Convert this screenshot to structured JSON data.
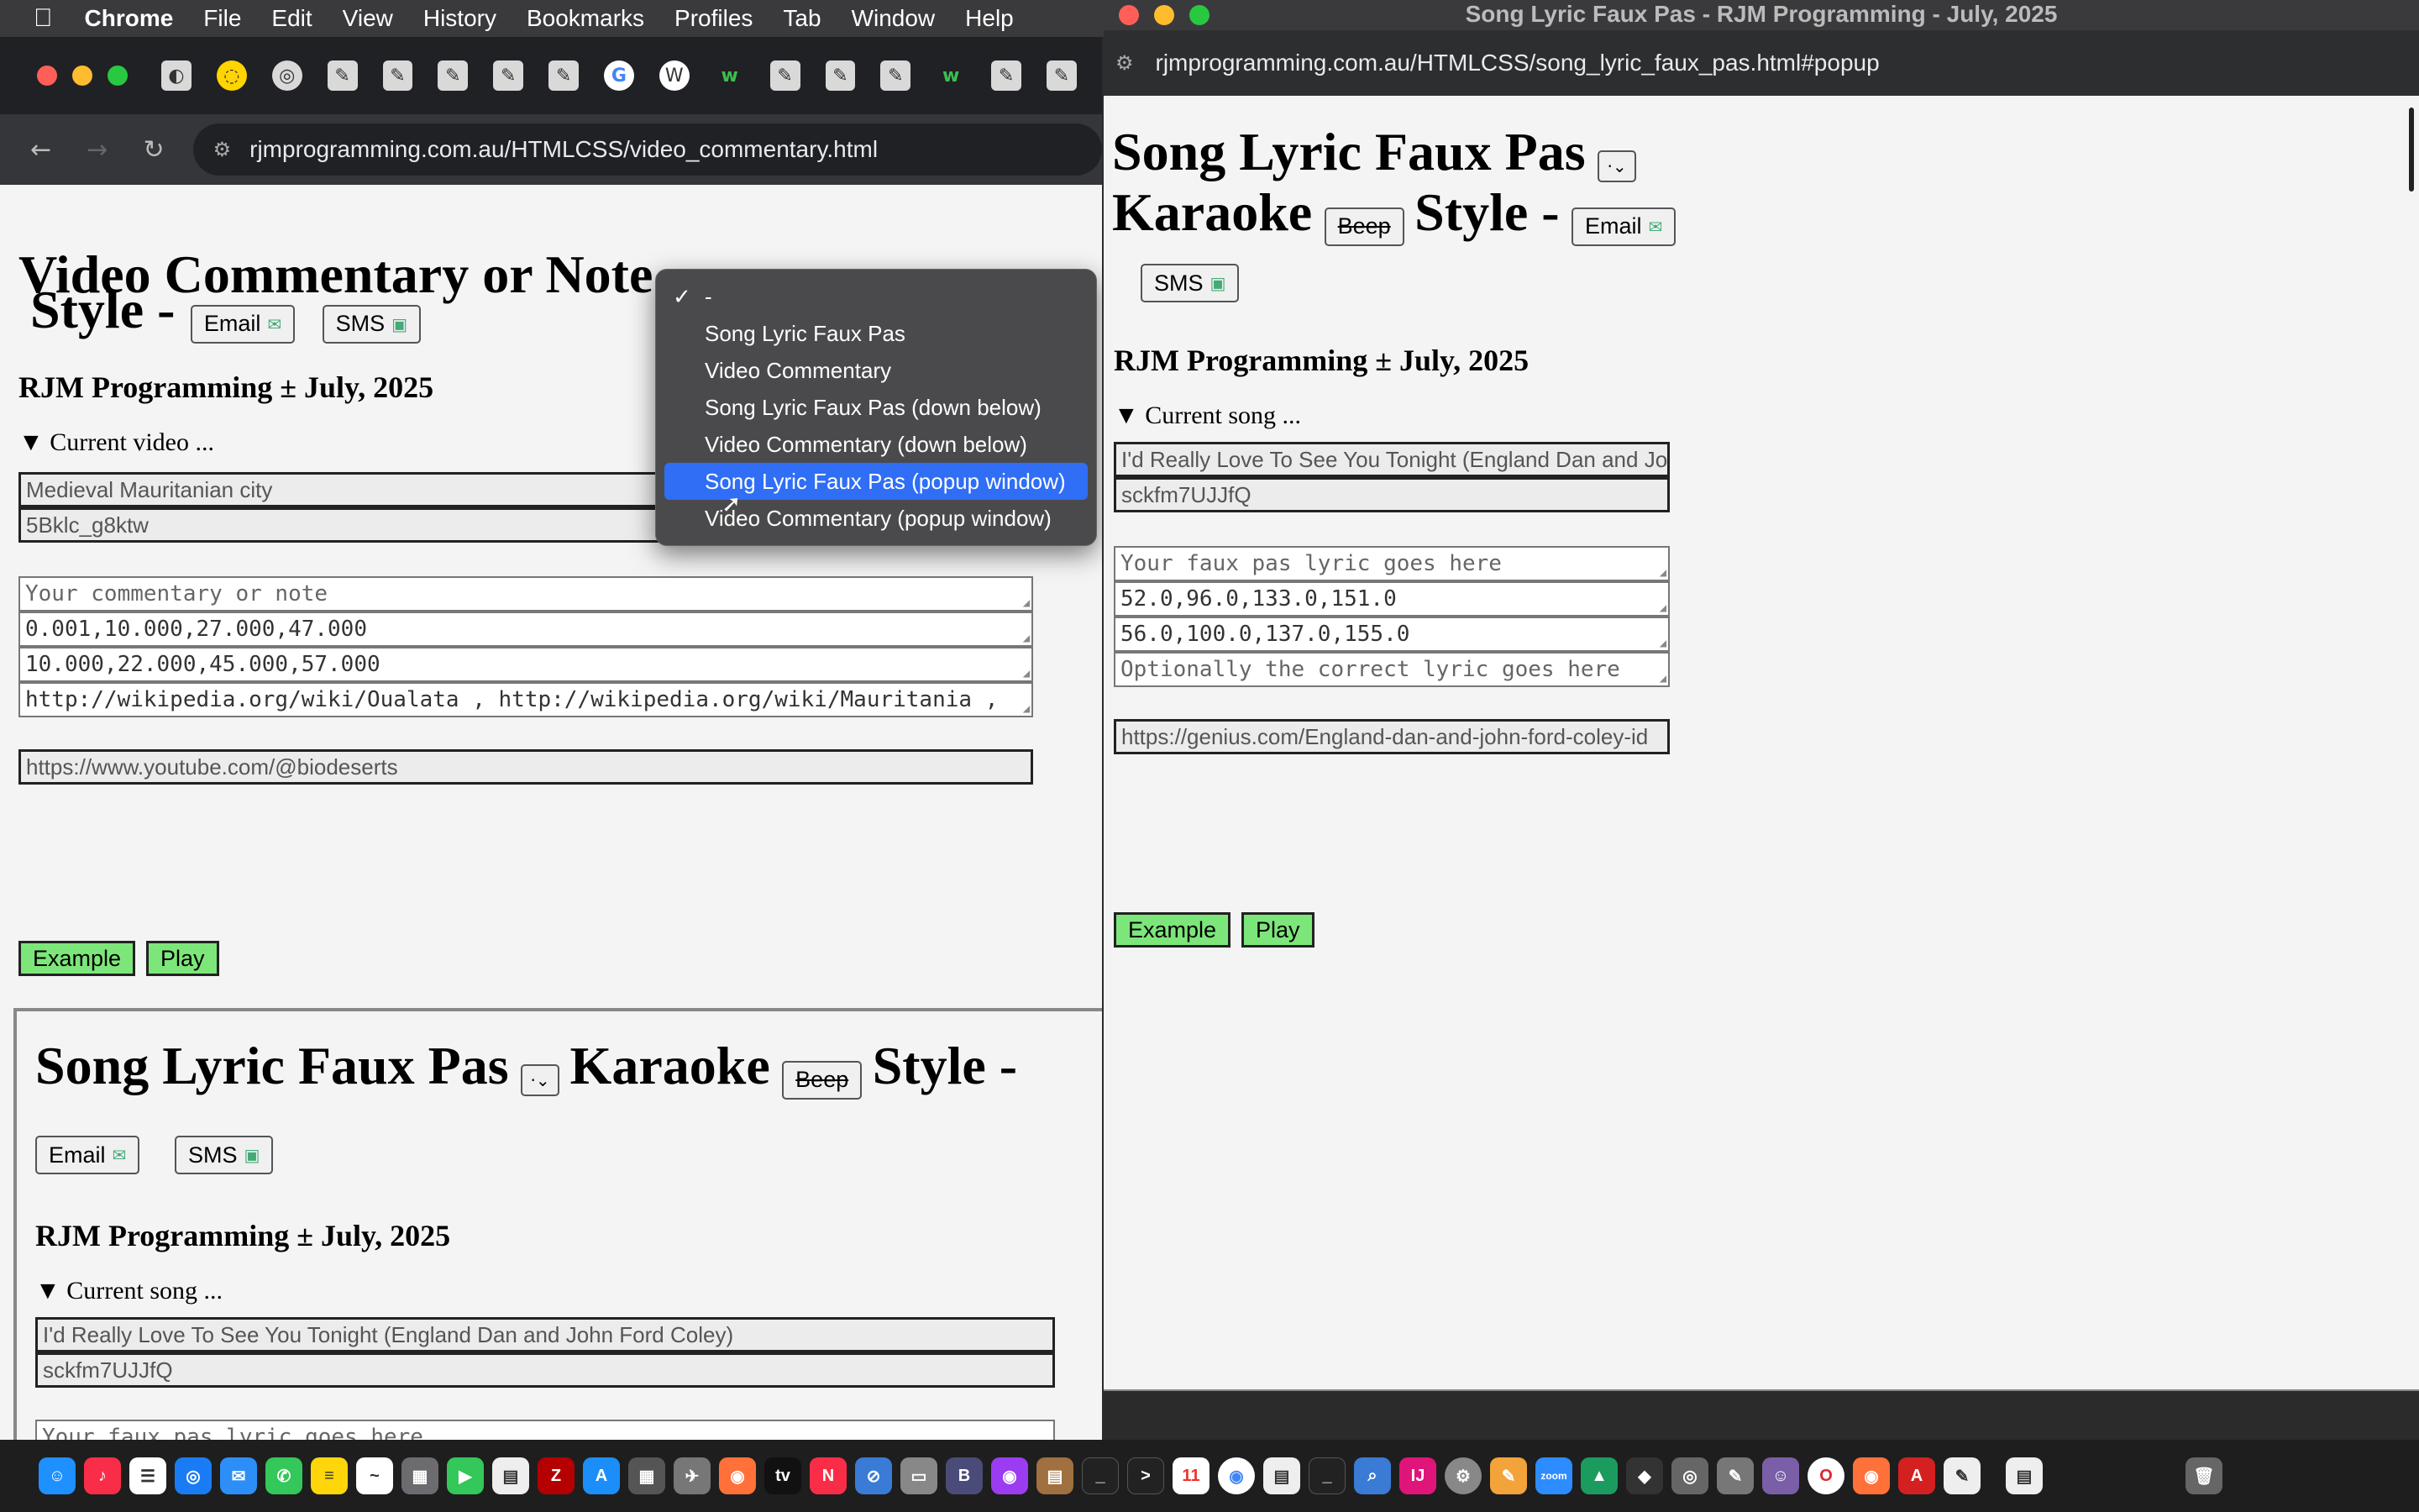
{
  "menubar": {
    "app": "Chrome",
    "items": [
      "File",
      "Edit",
      "View",
      "History",
      "Bookmarks",
      "Profiles",
      "Tab",
      "Window",
      "Help"
    ]
  },
  "left_window": {
    "url": "rjmprogramming.com.au/HTMLCSS/video_commentary.html",
    "tab_icons": [
      "page-icon",
      "spinner-icon",
      "elephant-icon",
      "page-icon",
      "page-icon",
      "page-icon",
      "page-icon",
      "page-icon",
      "google-icon",
      "wordpress-icon",
      "w-icon",
      "page-icon",
      "page-icon",
      "page-icon",
      "w-icon",
      "page-icon",
      "page-icon"
    ],
    "page": {
      "title_line1": "Video Commentary or Note",
      "title_line2": "Style -",
      "email_label": "Email",
      "sms_label": "SMS",
      "byline": "RJM Programming ± July, 2025",
      "details_summary": "Current video ...",
      "video_title": "Medieval Mauritanian city",
      "video_id": "5Bklc_g8ktw",
      "commentary_placeholder": "Your commentary or note",
      "start_times": "0.001,10.000,27.000,47.000",
      "end_times": "10.000,22.000,45.000,57.000",
      "links": "http://wikipedia.org/wiki/Oualata , http://wikipedia.org/wiki/Mauritania ,",
      "channel_url": "https://www.youtube.com/@biodeserts",
      "example_label": "Example",
      "play_label": "Play"
    },
    "embedded": {
      "title_part1": "Song Lyric Faux Pas",
      "select_value": "·",
      "title_part2": "Karaoke",
      "beep_label": "Beep",
      "title_part3": "Style -",
      "email_label": "Email",
      "sms_label": "SMS",
      "byline": "RJM Programming ± July, 2025",
      "details_summary": "Current song ...",
      "song_title": "I'd Really Love To See You Tonight (England Dan and John Ford Coley)",
      "song_id": "sckfm7UJJfQ",
      "lyric_placeholder": "Your faux pas lyric goes here"
    },
    "dropdown": {
      "options": [
        {
          "label": "-",
          "checked": true,
          "selected": false
        },
        {
          "label": "Song Lyric Faux Pas",
          "checked": false,
          "selected": false
        },
        {
          "label": "Video Commentary",
          "checked": false,
          "selected": false
        },
        {
          "label": "Song Lyric Faux Pas (down below)",
          "checked": false,
          "selected": false
        },
        {
          "label": "Video Commentary (down below)",
          "checked": false,
          "selected": false
        },
        {
          "label": "Song Lyric Faux Pas (popup window)",
          "checked": false,
          "selected": true
        },
        {
          "label": "Video Commentary (popup window)",
          "checked": false,
          "selected": false
        }
      ]
    }
  },
  "right_window": {
    "window_title": "Song Lyric Faux Pas - RJM Programming - July, 2025",
    "url": "rjmprogramming.com.au/HTMLCSS/song_lyric_faux_pas.html#popup",
    "page": {
      "title_part1": "Song Lyric Faux Pas",
      "select_value": "·",
      "title_part2": "Karaoke",
      "beep_label": "Beep",
      "title_part3": "Style -",
      "email_label": "Email",
      "sms_label": "SMS",
      "byline": "RJM Programming ± July, 2025",
      "details_summary": "Current song ...",
      "song_title": "I'd Really Love To See You Tonight (England Dan and John Ford Coley)",
      "song_id": "sckfm7UJJfQ",
      "lyric_placeholder": "Your faux pas lyric goes here",
      "start_times": "52.0,96.0,133.0,151.0",
      "end_times": "56.0,100.0,137.0,155.0",
      "correct_placeholder": "Optionally the correct lyric goes here",
      "lyrics_url": "https://genius.com/England-dan-and-john-ford-coley-id",
      "example_label": "Example",
      "play_label": "Play"
    }
  },
  "dock": {
    "icons": [
      "finder-icon",
      "music-icon",
      "reminders-icon",
      "safari-icon",
      "mail-icon",
      "messages-icon",
      "notes-icon",
      "freeform-icon",
      "launchpad-icon",
      "facetime-icon",
      "document-icon",
      "filezilla-icon",
      "appstore-icon",
      "calculator-icon",
      "preview-icon",
      "firefox-icon",
      "appletv-icon",
      "news-icon",
      "settings-icon",
      "photos-icon",
      "bbedit-icon",
      "podcasts-icon",
      "files-icon",
      "terminal-icon",
      "terminal-icon",
      "calendar-icon",
      "chrome-icon",
      "document-icon",
      "terminal-icon",
      "search-icon",
      "intellij-icon",
      "gear-icon",
      "paint-icon",
      "zoom-icon",
      "affinity-icon",
      "inkscape-icon",
      "elephant-icon",
      "script-icon",
      "ghost-icon",
      "opera-icon",
      "firefox-icon",
      "acrobat-icon",
      "textedit-icon",
      "document-icon",
      "trash-icon"
    ],
    "calendar_day": "11",
    "zoom_label": "zoom"
  }
}
